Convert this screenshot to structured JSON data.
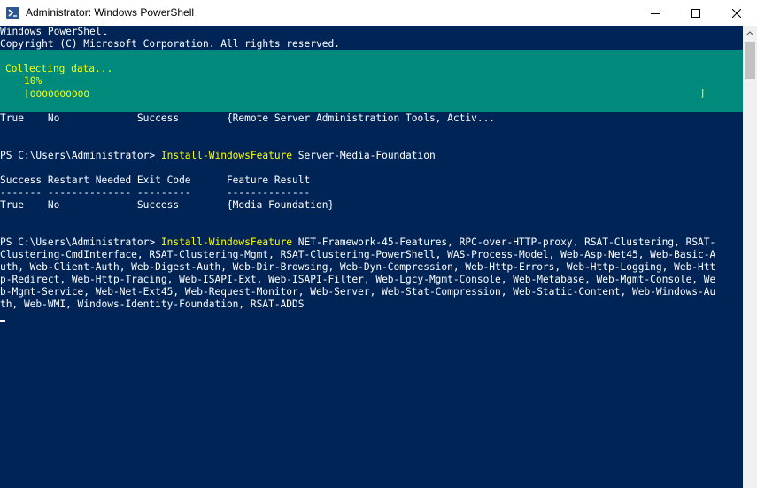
{
  "window": {
    "title": "Administrator: Windows PowerShell"
  },
  "console": {
    "banner_line1": "Windows PowerShell",
    "banner_line2": "Copyright (C) Microsoft Corporation. All rights reserved.",
    "prev_result": "True    No             Success        {Remote Server Administration Tools, Activ...",
    "prompt1": "PS C:\\Users\\Administrator> ",
    "cmd1": "Install-WindowsFeature",
    "args1": " Server-Media-Foundation",
    "header_line": "Success Restart Needed Exit Code      Feature Result",
    "dash_line": "------- -------------- ---------      --------------",
    "result_line": "True    No             Success        {Media Foundation}",
    "prompt2": "PS C:\\Users\\Administrator> ",
    "cmd2": "Install-WindowsFeature",
    "args2_line1": " NET-Framework-45-Features, RPC-over-HTTP-proxy, RSAT-Clustering, RSAT-",
    "args2_line2": "Clustering-CmdInterface, RSAT-Clustering-Mgmt, RSAT-Clustering-PowerShell, WAS-Process-Model, Web-Asp-Net45, Web-Basic-A",
    "args2_line3": "uth, Web-Client-Auth, Web-Digest-Auth, Web-Dir-Browsing, Web-Dyn-Compression, Web-Http-Errors, Web-Http-Logging, Web-Htt",
    "args2_line4": "p-Redirect, Web-Http-Tracing, Web-ISAPI-Ext, Web-ISAPI-Filter, Web-Lgcy-Mgmt-Console, Web-Metabase, Web-Mgmt-Console, We",
    "args2_line5": "b-Mgmt-Service, Web-Net-Ext45, Web-Request-Monitor, Web-Server, Web-Stat-Compression, Web-Static-Content, Web-Windows-Au",
    "args2_line6": "th, Web-WMI, Windows-Identity-Foundation, RSAT-ADDS"
  },
  "progress": {
    "activity": "Collecting data...",
    "percent_text": "10%",
    "bar_text": "[oooooooooo",
    "bar_end": "]",
    "percent": 10
  },
  "colors": {
    "console_bg": "#012456",
    "progress_bg": "#008a7c",
    "command": "#ffff00",
    "text": "#ffffff"
  },
  "icons": {
    "app": "powershell-icon",
    "minimize": "minimize-icon",
    "maximize": "maximize-icon",
    "close": "close-icon",
    "scroll_up": "scroll-up-arrow-icon"
  }
}
